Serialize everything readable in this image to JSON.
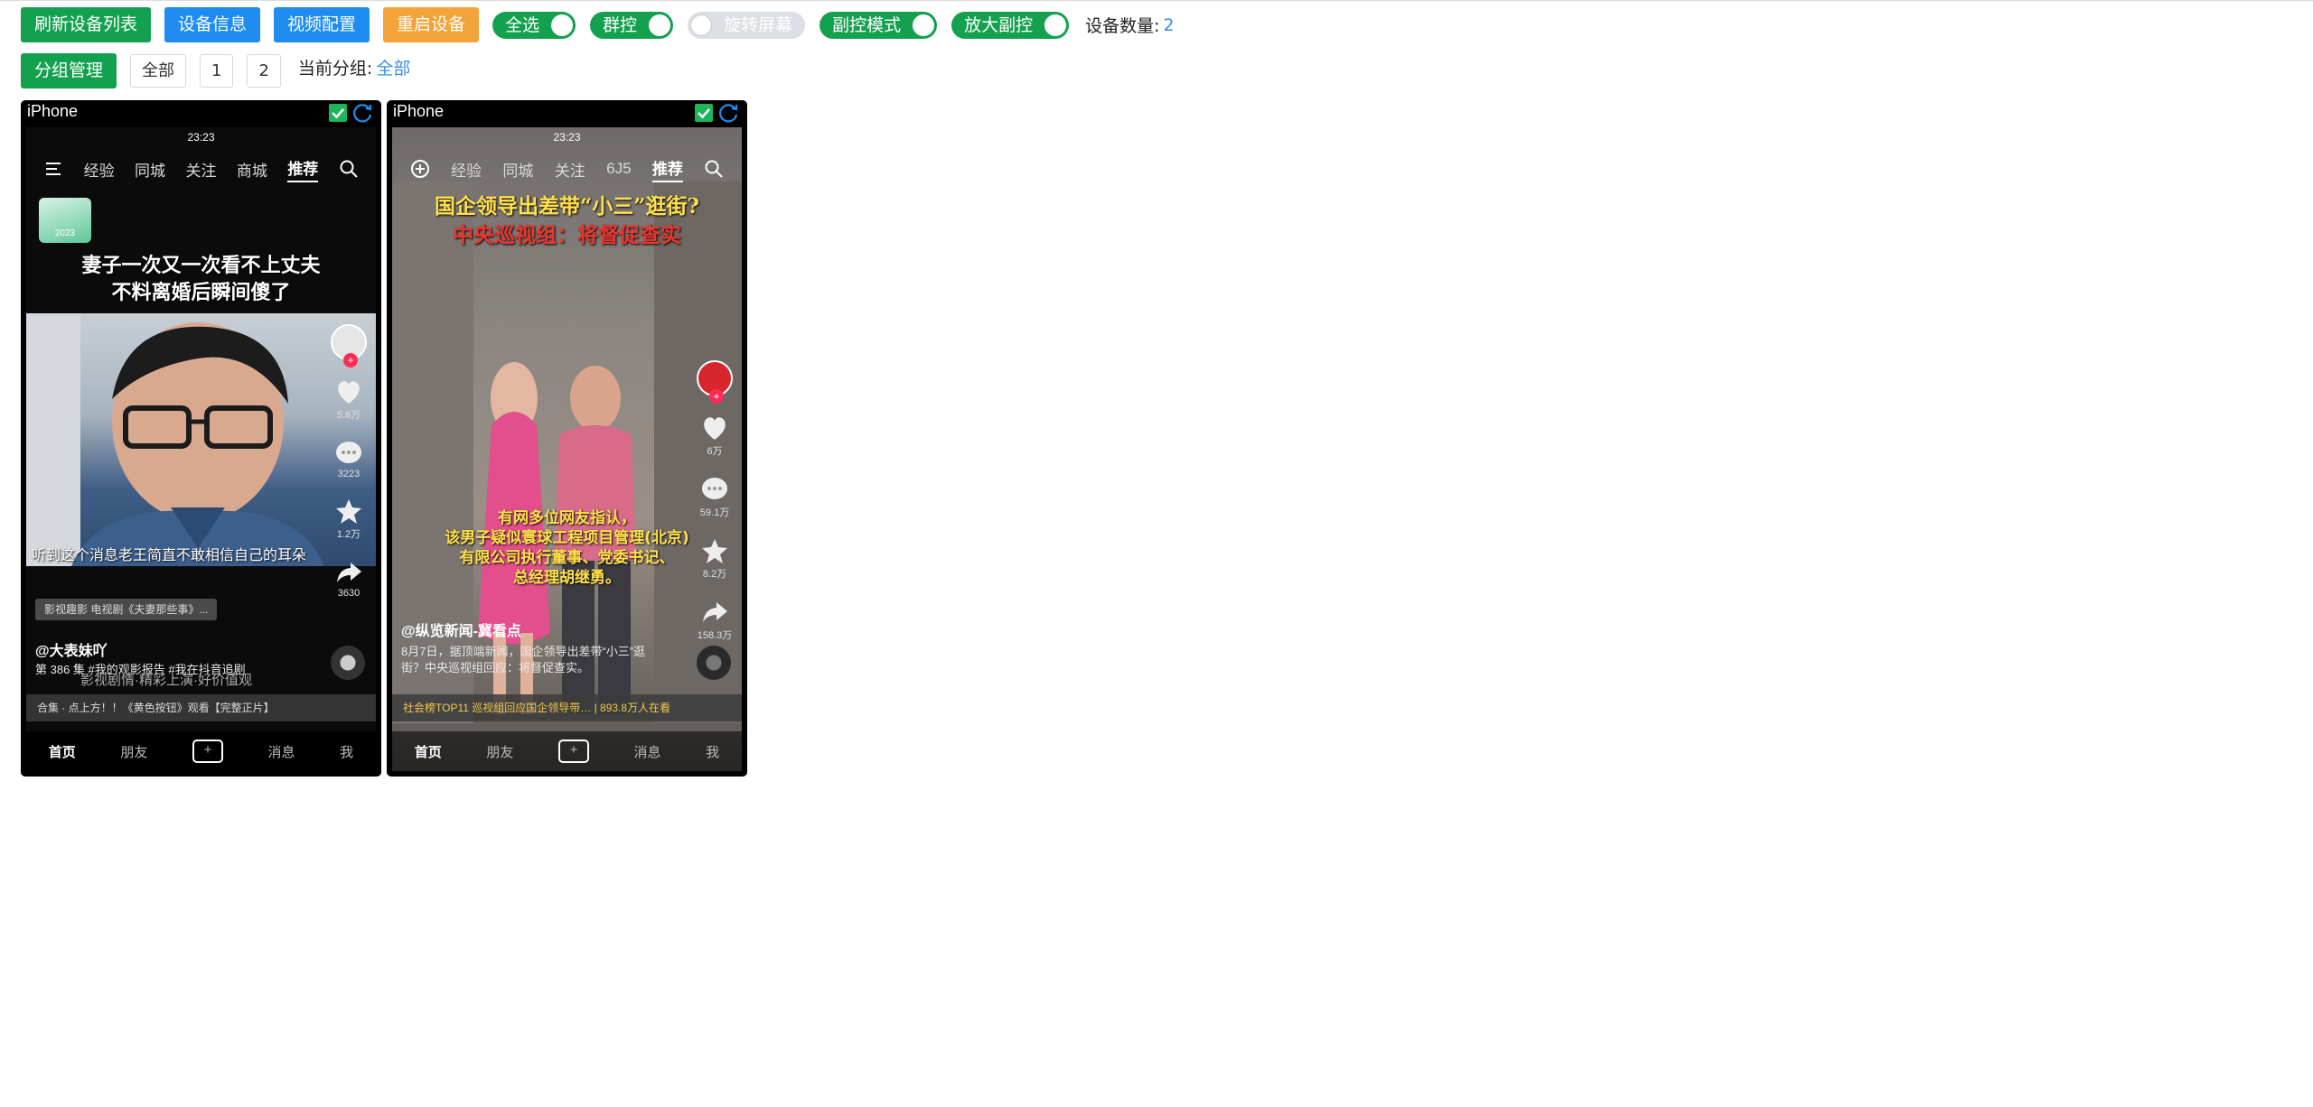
{
  "toolbar": {
    "refresh_label": "刷新设备列表",
    "info_label": "设备信息",
    "video_label": "视频配置",
    "restart_label": "重启设备",
    "switches": [
      {
        "label": "全选",
        "state": "on"
      },
      {
        "label": "群控",
        "state": "on"
      },
      {
        "label": "旋转屏幕",
        "state": "off"
      },
      {
        "label": "副控模式",
        "state": "on"
      },
      {
        "label": "放大副控",
        "state": "on"
      }
    ],
    "count_label": "设备数量:",
    "count_value": "2"
  },
  "groups": {
    "manage_label": "分组管理",
    "chips": [
      "全部",
      "1",
      "2"
    ],
    "current_label": "当前分组:",
    "current_value": "全部"
  },
  "devices": [
    {
      "name": "iPhone",
      "checked": true,
      "status_time": "23:23",
      "nav": [
        "经验",
        "同城",
        "关注",
        "商城",
        "推荐"
      ],
      "active_nav": "推荐",
      "caption_line1": "妻子一次又一次看不上丈夫",
      "caption_line2": "不料离婚后瞬间傻了",
      "badge": "2023",
      "subtitle": "听到这个消息老王简直不敢相信自己的耳朵",
      "likes": "5.6万",
      "comments": "3223",
      "favorites": "1.2万",
      "shares": "3630",
      "tag": "影视趣影  电视剧《夫妻那些事》...",
      "author": "@大表妹吖",
      "desc": "第 386 集 #我的观影报告 #我在抖音追剧",
      "desc_overlay": "影视剧情·精彩上演·好价值观",
      "collection": "合集 · 点上方！！《黄色按钮》观看【完整正片】",
      "tabs": [
        "首页",
        "朋友",
        "+",
        "消息",
        "我"
      ]
    },
    {
      "name": "iPhone",
      "checked": true,
      "status_time": "23:23",
      "nav": [
        "经验",
        "同城",
        "关注",
        "6J5",
        "推荐"
      ],
      "active_nav": "推荐",
      "caption_line1": "国企领导出差带“小三”逛街?",
      "caption_line2": "中央巡视组：将督促查实",
      "overlay_text": [
        "有网多位网友指认，",
        "该男子疑似寰球工程项目管理(北京)",
        "有限公司执行董事、党委书记、",
        "总经理胡继勇。"
      ],
      "likes": "6万",
      "comments": "59.1万",
      "favorites": "8.2万",
      "shares": "158.3万",
      "author": "@纵览新闻-冀看点",
      "desc": "8月7日，据顶端新闻，国企领导出差带“小三”逛街？中央巡视组回应：将督促查实。",
      "collection": "社会榜TOP11  巡视组回应国企领导带…  |  893.8万人在看",
      "tabs": [
        "首页",
        "朋友",
        "+",
        "消息",
        "我"
      ]
    }
  ],
  "colors": {
    "green": "#13a14f",
    "blue": "#1e8cf0",
    "orange": "#f2a43a",
    "link": "#3a8ee6"
  }
}
